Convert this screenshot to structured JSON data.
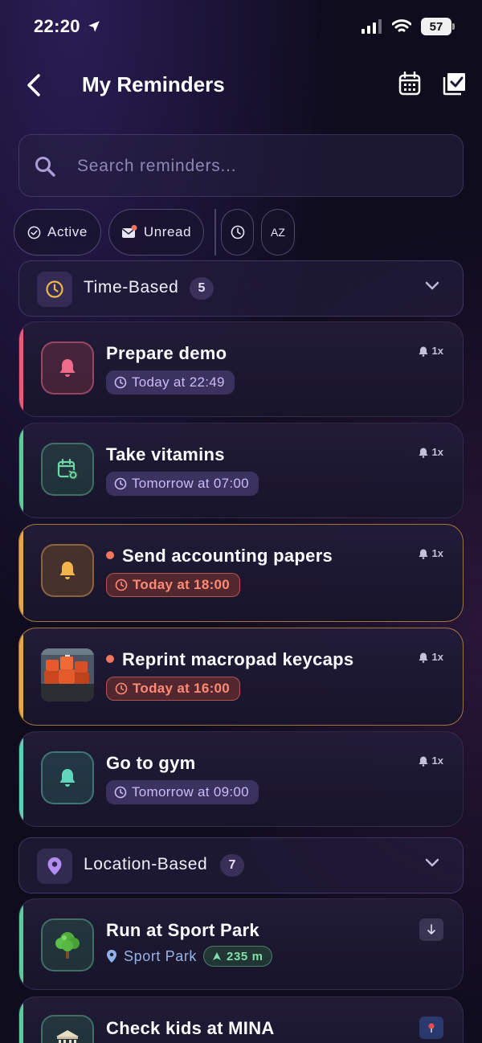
{
  "status_bar": {
    "time": "22:20",
    "battery": "57"
  },
  "header": {
    "title": "My Reminders"
  },
  "search": {
    "placeholder": "Search reminders..."
  },
  "filters": {
    "active_label": "Active",
    "unread_label": "Unread",
    "sort_alpha_label": "AZ"
  },
  "time_section": {
    "title": "Time-Based",
    "count": "5"
  },
  "reminders": [
    {
      "title": "Prepare demo",
      "time": "Today at 22:49",
      "repeat": "1x",
      "accent": "#e0607a",
      "urgent": false,
      "unread": false
    },
    {
      "title": "Take vitamins",
      "time": "Tomorrow at 07:00",
      "repeat": "1x",
      "accent": "#5ec99a",
      "urgent": false,
      "unread": false
    },
    {
      "title": "Send accounting papers",
      "time": "Today at 18:00",
      "repeat": "1x",
      "accent": "#e8a648",
      "urgent": true,
      "unread": true
    },
    {
      "title": "Reprint macropad keycaps",
      "time": "Today at 16:00",
      "repeat": "1x",
      "accent": "#e8a648",
      "urgent": true,
      "unread": true
    },
    {
      "title": "Go to gym",
      "time": "Tomorrow at 09:00",
      "repeat": "1x",
      "accent": "#5fcfb4",
      "urgent": false,
      "unread": false
    }
  ],
  "location_section": {
    "title": "Location-Based",
    "count": "7"
  },
  "locations": [
    {
      "title": "Run at Sport Park",
      "place": "Sport Park",
      "distance": "235 m",
      "accent": "#5ec99a"
    },
    {
      "title": "Check kids at MINA",
      "accent": "#5ec99a"
    }
  ]
}
